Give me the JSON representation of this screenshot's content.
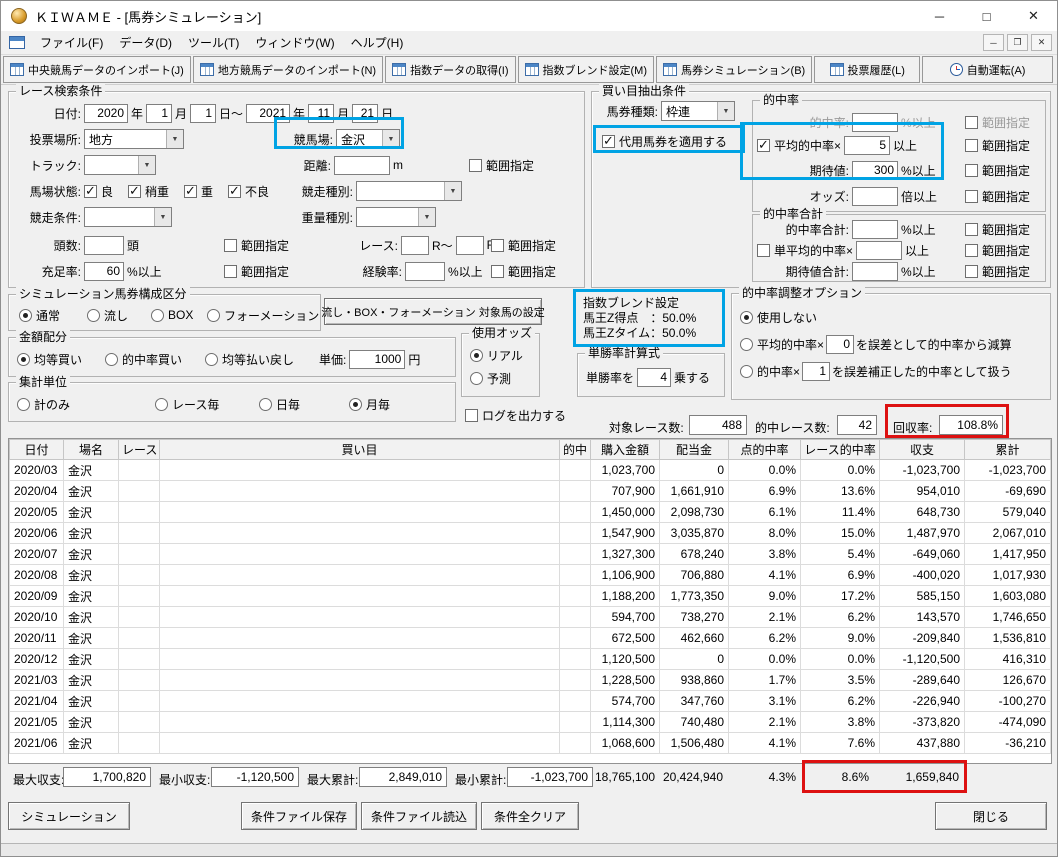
{
  "window": {
    "title": "ＫＩＷＡＭＥ - [馬券シミュレーション]"
  },
  "icons": {
    "minimize": "─",
    "maximize": "□",
    "close": "✕",
    "restore": "❐"
  },
  "menu": {
    "items": [
      "ファイル(F)",
      "データ(D)",
      "ツール(T)",
      "ウィンドウ(W)",
      "ヘルプ(H)"
    ]
  },
  "toolbar": {
    "buttons": [
      "中央競馬データのインポート(J)",
      "地方競馬データのインポート(N)",
      "指数データの取得(I)",
      "指数ブレンド設定(M)",
      "馬券シミュレーション(B)",
      "投票履歴(L)",
      "自動運転(A)"
    ]
  },
  "labels": {
    "range": "範囲指定"
  },
  "search": {
    "title": "レース検索条件",
    "date_label": "日付:",
    "date": {
      "y1": "2020",
      "m1": "1",
      "d1": "1",
      "y2": "2021",
      "m2": "11",
      "d2": "21"
    },
    "date_units": {
      "year1": "年",
      "month1": "月",
      "day1": "日～",
      "year2": "年",
      "month2": "月",
      "day2": "日"
    },
    "place_label": "投票場所:",
    "place_value": "地方",
    "track_label": "トラック:",
    "track_value": "",
    "ground_label": "馬場状態:",
    "ground": [
      {
        "label": "良",
        "checked": true
      },
      {
        "label": "稍重",
        "checked": true
      },
      {
        "label": "重",
        "checked": true
      },
      {
        "label": "不良",
        "checked": true
      }
    ],
    "cond_label": "競走条件:",
    "cond_value": "",
    "heads_label": "頭数:",
    "heads_value": "",
    "heads_unit": "頭",
    "fill_label": "充足率:",
    "fill_value": "60",
    "fill_unit": "%以上",
    "course_label": "競馬場:",
    "course_value": "金沢",
    "distance_label": "距離:",
    "distance_value": "",
    "distance_unit": "m",
    "rtype_label": "競走種別:",
    "rtype_value": "",
    "wtype_label": "重量種別:",
    "wtype_value": "",
    "race_label": "レース:",
    "race_from": "",
    "race_unit1": "R～",
    "race_to": "",
    "race_unit2": "R",
    "exp_label": "経験率:",
    "exp_value": "",
    "exp_unit": "%以上"
  },
  "extract": {
    "title": "買い目抽出条件",
    "ticket_label": "馬券種類:",
    "ticket_value": "枠連",
    "substitute_label": "代用馬券を適用する",
    "substitute_checked": true,
    "hit": {
      "title": "的中率",
      "rate_label": "的中率:",
      "rate_value": "",
      "rate_unit": "%以上",
      "avg_label": "平均的中率×",
      "avg_value": "5",
      "avg_unit": "以上",
      "avg_checked": true,
      "expect_label": "期待値:",
      "expect_value": "300",
      "expect_unit": "%以上",
      "odds_label": "オッズ:",
      "odds_value": "",
      "odds_unit": "倍以上"
    },
    "hitsum": {
      "title": "的中率合計",
      "sum_label": "的中率合計:",
      "sum_value": "",
      "sum_unit": "%以上",
      "avg_label": "単平均的中率×",
      "avg_value": "",
      "avg_unit": "以上",
      "avg_checked": false,
      "expect_label": "期待値合計:",
      "expect_value": "",
      "expect_unit": "%以上"
    }
  },
  "simtype": {
    "title": "シミュレーション馬券構成区分",
    "options": [
      {
        "label": "通常",
        "selected": true
      },
      {
        "label": "流し",
        "selected": false
      },
      {
        "label": "BOX",
        "selected": false
      },
      {
        "label": "フォーメーション",
        "selected": false
      }
    ]
  },
  "target_button": "流し・BOX・フォーメーション 対象馬の設定",
  "blend": {
    "title": "指数ブレンド設定",
    "line1": "馬王Z得点　：50.0%",
    "line2": "馬王Zタイム：50.0%"
  },
  "adjust": {
    "title": "的中率調整オプション",
    "opt1": {
      "label": "使用しない",
      "selected": true
    },
    "opt2": {
      "pre": "平均的中率×",
      "value": "0",
      "post": "を誤差として的中率から減算",
      "selected": false
    },
    "opt3": {
      "pre": "的中率×",
      "value": "1",
      "post": "を誤差補正した的中率として扱う",
      "selected": false
    }
  },
  "amount": {
    "title": "金額配分",
    "options": [
      {
        "label": "均等買い",
        "selected": true
      },
      {
        "label": "的中率買い",
        "selected": false
      },
      {
        "label": "均等払い戻し",
        "selected": false
      }
    ],
    "unit_label": "単価:",
    "unit_value": "1000",
    "unit_suffix": "円"
  },
  "odds": {
    "title": "使用オッズ",
    "options": [
      {
        "label": "リアル",
        "selected": true
      },
      {
        "label": "予測",
        "selected": false
      }
    ]
  },
  "winrate": {
    "title": "単勝率計算式",
    "pre": "単勝率を",
    "value": "4",
    "post": "乗する"
  },
  "agg": {
    "title": "集計単位",
    "options": [
      {
        "label": "計のみ",
        "selected": false
      },
      {
        "label": "レース毎",
        "selected": false
      },
      {
        "label": "日毎",
        "selected": false
      },
      {
        "label": "月毎",
        "selected": true
      }
    ]
  },
  "log_label": "ログを出力する",
  "stats": {
    "target_label": "対象レース数:",
    "target_value": "488",
    "hit_label": "的中レース数:",
    "hit_value": "42",
    "recovery_label": "回収率:",
    "recovery_value": "108.8%"
  },
  "table": {
    "headers": [
      "日付",
      "場名",
      "レース",
      "買い目",
      "的中",
      "購入金額",
      "配当金",
      "点的中率",
      "レース的中率",
      "収支",
      "累計"
    ],
    "rows": [
      [
        "2020/03",
        "金沢",
        "",
        "",
        "",
        "1,023,700",
        "0",
        "0.0%",
        "0.0%",
        "-1,023,700",
        "-1,023,700"
      ],
      [
        "2020/04",
        "金沢",
        "",
        "",
        "",
        "707,900",
        "1,661,910",
        "6.9%",
        "13.6%",
        "954,010",
        "-69,690"
      ],
      [
        "2020/05",
        "金沢",
        "",
        "",
        "",
        "1,450,000",
        "2,098,730",
        "6.1%",
        "11.4%",
        "648,730",
        "579,040"
      ],
      [
        "2020/06",
        "金沢",
        "",
        "",
        "",
        "1,547,900",
        "3,035,870",
        "8.0%",
        "15.0%",
        "1,487,970",
        "2,067,010"
      ],
      [
        "2020/07",
        "金沢",
        "",
        "",
        "",
        "1,327,300",
        "678,240",
        "3.8%",
        "5.4%",
        "-649,060",
        "1,417,950"
      ],
      [
        "2020/08",
        "金沢",
        "",
        "",
        "",
        "1,106,900",
        "706,880",
        "4.1%",
        "6.9%",
        "-400,020",
        "1,017,930"
      ],
      [
        "2020/09",
        "金沢",
        "",
        "",
        "",
        "1,188,200",
        "1,773,350",
        "9.0%",
        "17.2%",
        "585,150",
        "1,603,080"
      ],
      [
        "2020/10",
        "金沢",
        "",
        "",
        "",
        "594,700",
        "738,270",
        "2.1%",
        "6.2%",
        "143,570",
        "1,746,650"
      ],
      [
        "2020/11",
        "金沢",
        "",
        "",
        "",
        "672,500",
        "462,660",
        "6.2%",
        "9.0%",
        "-209,840",
        "1,536,810"
      ],
      [
        "2020/12",
        "金沢",
        "",
        "",
        "",
        "1,120,500",
        "0",
        "0.0%",
        "0.0%",
        "-1,120,500",
        "416,310"
      ],
      [
        "2021/03",
        "金沢",
        "",
        "",
        "",
        "1,228,500",
        "938,860",
        "1.7%",
        "3.5%",
        "-289,640",
        "126,670"
      ],
      [
        "2021/04",
        "金沢",
        "",
        "",
        "",
        "574,700",
        "347,760",
        "3.1%",
        "6.2%",
        "-226,940",
        "-100,270"
      ],
      [
        "2021/05",
        "金沢",
        "",
        "",
        "",
        "1,114,300",
        "740,480",
        "2.1%",
        "3.8%",
        "-373,820",
        "-474,090"
      ],
      [
        "2021/06",
        "金沢",
        "",
        "",
        "",
        "1,068,600",
        "1,506,480",
        "4.1%",
        "7.6%",
        "437,880",
        "-36,210"
      ]
    ]
  },
  "footer": {
    "max_balance_label": "最大収支:",
    "max_balance": "1,700,820",
    "min_balance_label": "最小収支:",
    "min_balance": "-1,120,500",
    "max_cum_label": "最大累計:",
    "max_cum": "2,849,010",
    "min_cum_label": "最小累計:",
    "min_cum": "-1,023,700",
    "total_purchase": "18,765,100",
    "total_payout": "20,424,940",
    "total_point_rate": "4.3%",
    "total_race_rate": "8.6%",
    "total_balance": "1,659,840"
  },
  "actions": {
    "simulate": "シミュレーション",
    "save": "条件ファイル保存",
    "load": "条件ファイル読込",
    "clear": "条件全クリア",
    "close": "閉じる"
  }
}
